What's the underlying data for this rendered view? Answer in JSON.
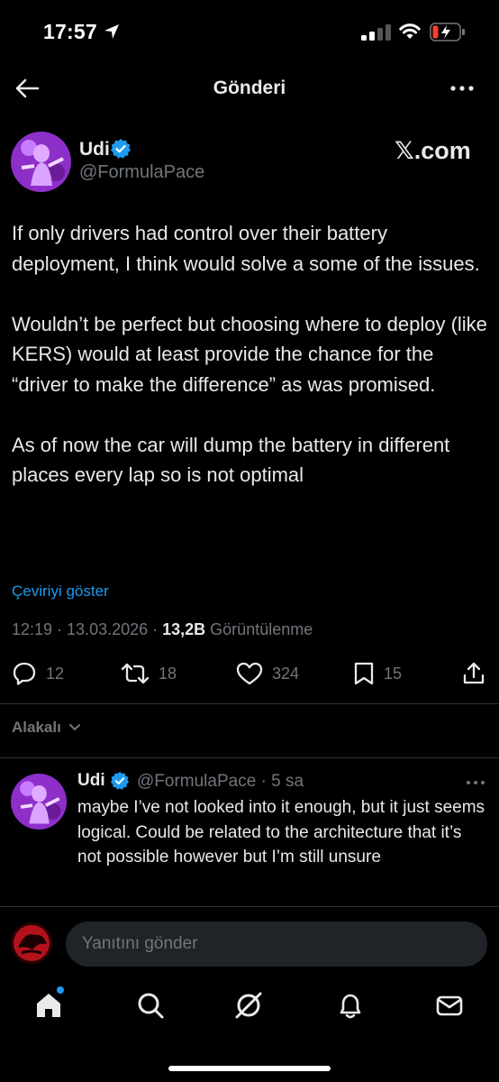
{
  "status_bar": {
    "time": "17:57"
  },
  "nav": {
    "title": "Gönderi"
  },
  "post": {
    "author_name": "Udi",
    "handle": "@FormulaPace",
    "brand_label": "𝕏.com",
    "paragraphs": [
      "If only drivers had control over their battery deployment, I think would solve a some of the issues.",
      "Wouldn’t be perfect but choosing where to deploy (like KERS) would at least provide the chance for the “driver to make the difference” as was promised.",
      "As of now the car will dump the battery in different places every lap so is not optimal"
    ],
    "translate_label": "Çeviriyi göster",
    "timestamp": "12:19 · 13.03.2026 · ",
    "views_count": "13,2B",
    "views_label": " Görüntülenme",
    "counts": {
      "replies": "12",
      "reposts": "18",
      "likes": "324",
      "bookmarks": "15"
    }
  },
  "sort_label": "Alakalı",
  "reply": {
    "author_name": "Udi",
    "handle_time": "@FormulaPace · 5 sa",
    "text": "maybe I’ve not looked into it enough, but it just seems logical. Could be related to the architecture that it’s not possible however but I’m still unsure"
  },
  "compose": {
    "placeholder": "Yanıtını gönder"
  },
  "colors": {
    "accent": "#1d9bf0",
    "background": "#000000",
    "muted": "#71767b",
    "text": "#e7e9ea"
  },
  "icons": [
    "location-arrow-icon",
    "signal-icon",
    "wifi-icon",
    "battery-charging-icon",
    "back-arrow-icon",
    "more-icon",
    "verified-icon",
    "reply-icon",
    "repost-icon",
    "like-icon",
    "bookmark-icon",
    "share-icon",
    "chevron-down-icon",
    "home-icon",
    "search-icon",
    "grok-icon",
    "notifications-icon",
    "messages-icon"
  ]
}
